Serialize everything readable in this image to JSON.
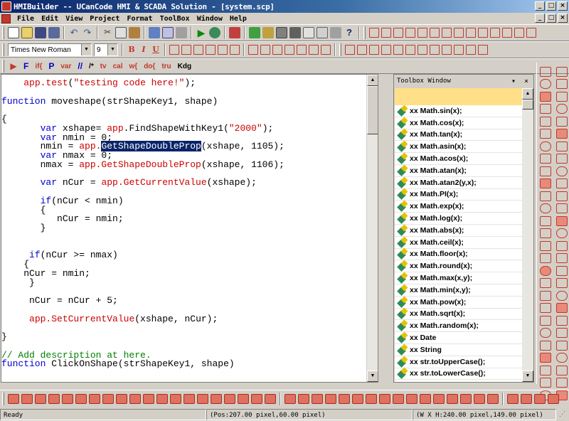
{
  "window": {
    "title": "HMIBuilder -- UCanCode HMI & SCADA Solution - [system.scp]",
    "controls": [
      "_",
      "□",
      "×"
    ],
    "mdi_controls": [
      "_",
      "□",
      "×"
    ]
  },
  "menu": [
    "File",
    "Edit",
    "View",
    "Project",
    "Format",
    "ToolBox",
    "Window",
    "Help"
  ],
  "format_toolbar": {
    "font": "Times New Roman",
    "size": "9",
    "buttons": [
      "B",
      "I",
      "U"
    ]
  },
  "code_toolbar": {
    "buttons": [
      "F",
      "if{",
      "P",
      "var",
      "//",
      "/*",
      "tv",
      "cal",
      "w{",
      "do{",
      "tru",
      "Kdg"
    ]
  },
  "editor": {
    "lines": [
      "    app.test(\"testing code here!\");",
      "",
      "function moveshape(strShapeKey1, shape)",
      "",
      "{",
      "       var xshape= app.FindShapeWithKey1(\"2000\");",
      "       var nmin = 0;",
      "       nmin = app.GetShapeDoubleProp(xshape, 1105);",
      "       var nmax = 0;",
      "       nmax = app.GetShapeDoubleProp(xshape, 1106);",
      "",
      "       var nCur = app.GetCurrentValue(xshape);",
      "",
      "       if(nCur < nmin)",
      "       {",
      "          nCur = nmin;",
      "       }",
      "",
      "",
      "     if(nCur >= nmax)",
      "    {",
      "    nCur = nmin;",
      "     }",
      "",
      "     nCur = nCur + 5;",
      "",
      "     app.SetCurrentValue(xshape, nCur);",
      "",
      "}",
      "",
      "// Add description at here.",
      "function ClickOnShape(strShapeKey1, shape)"
    ],
    "selected_text": "GetShapeDoubleProp"
  },
  "toolbox": {
    "title": "Toolbox Window",
    "header_controls": "▾ ×",
    "items": [
      "xx Math.sin(x);",
      "xx Math.cos(x);",
      "xx Math.tan(x);",
      "xx Math.asin(x);",
      "xx Math.acos(x);",
      "xx Math.atan(x);",
      "xx Math.atan2(y,x);",
      "xx Math.PI(x);",
      "xx Math.exp(x);",
      "xx Math.log(x);",
      "xx Math.abs(x);",
      "xx Math.ceil(x);",
      "xx Math.floor(x);",
      "xx Math.round(x);",
      "xx Math.max(x,y);",
      "xx Math.min(x,y);",
      "xx Math.pow(x);",
      "xx Math.sqrt(x);",
      "xx Math.random(x);",
      "xx Date",
      "xx String",
      "xx str.toUpperCase();",
      "xx str.toLowerCase();"
    ]
  },
  "status": {
    "ready": "Ready",
    "pos": "(Pos:207.00 pixel,60.00 pixel)",
    "size": "(W X H:240.00 pixel,149.00 pixel)"
  },
  "colors": {
    "titlebar": "#0a246a",
    "keyword": "#0000cc",
    "object": "#cc0000",
    "selection": "#0a246a",
    "toolbox_band": "#ffe088"
  }
}
